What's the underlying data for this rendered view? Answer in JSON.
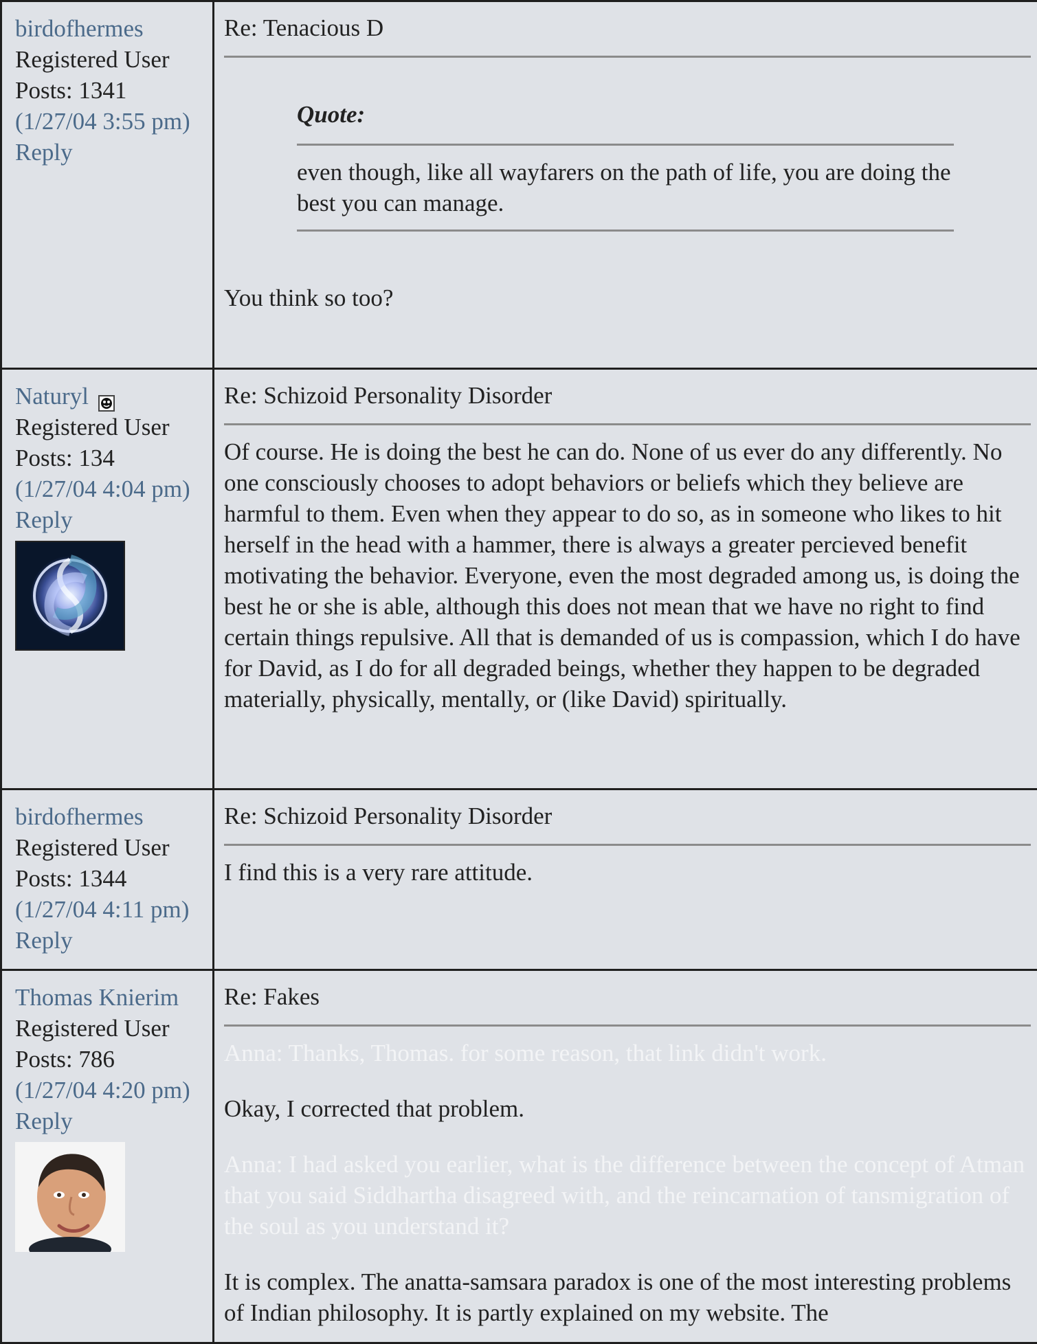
{
  "posts": [
    {
      "author": "birdofhermes",
      "role": "Registered User",
      "posts_label": "Posts: 1341",
      "time": "(1/27/04 3:55 pm)",
      "reply_label": "Reply",
      "subject": "Re: Tenacious D",
      "quote_label": "Quote:",
      "quote_text": "even though, like all wayfarers on the path of life, you are doing the best you can manage.",
      "body": "You think so too?"
    },
    {
      "author": "Naturyl",
      "role": "Registered User",
      "posts_label": "Posts: 134",
      "time": "(1/27/04 4:04 pm)",
      "reply_label": "Reply",
      "subject": "Re: Schizoid Personality Disorder",
      "body": "Of course. He is doing the best he can do. None of us ever do any differently. No one consciously chooses to adopt behaviors or beliefs which they believe are harmful to them. Even when they appear to do so, as in someone who likes to hit herself in the head with a hammer, there is always a greater percieved benefit motivating the behavior. Everyone, even the most degraded among us, is doing the best he or she is able, although this does not mean that we have no right to find certain things repulsive. All that is demanded of us is compassion, which I do have for David, as I do for all degraded beings, whether they happen to be degraded materially, physically, mentally, or (like David) spiritually."
    },
    {
      "author": "birdofhermes",
      "role": "Registered User",
      "posts_label": "Posts: 1344",
      "time": "(1/27/04 4:11 pm)",
      "reply_label": "Reply",
      "subject": "Re: Schizoid Personality Disorder",
      "body": "I find this is a very rare attitude."
    },
    {
      "author": "Thomas Knierim",
      "role": "Registered User",
      "posts_label": "Posts: 786",
      "time": "(1/27/04 4:20 pm)",
      "reply_label": "Reply",
      "subject": "Re: Fakes",
      "faint_1": "Anna: Thanks, Thomas. for some reason, that link didn't work.",
      "body_1": "Okay, I corrected that problem.",
      "faint_2": "Anna: I had asked you earlier, what is the difference between the concept of Atman that you said Siddhartha disagreed with, and the reincarnation of tansmigration of the soul as you understand it?",
      "body_2": "It is complex. The anatta-samsara paradox is one of the most interesting problems of Indian philosophy. It is partly explained on my website. The"
    }
  ],
  "icons": {
    "status": "status-icon",
    "avatar_naturyl": "abstract-orb-avatar",
    "avatar_thomas": "portrait-avatar"
  },
  "colors": {
    "background": "#dfe2e7",
    "border": "#1f1f1f",
    "link": "#4b6a8a",
    "rule": "#8b8b8b",
    "faint_text": "#f3f4f6"
  }
}
